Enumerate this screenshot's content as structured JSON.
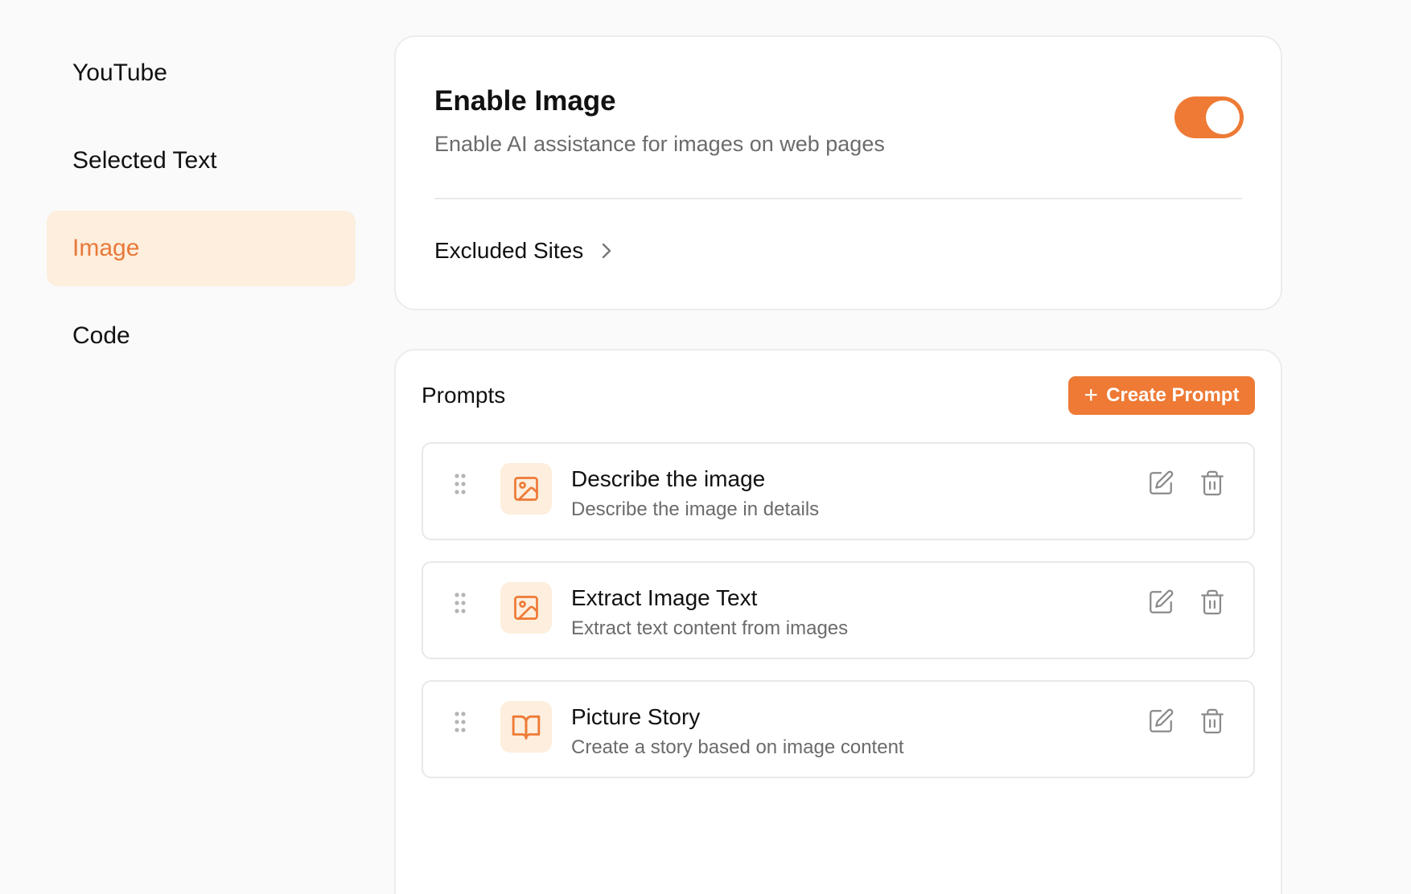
{
  "sidebar": {
    "items": [
      {
        "label": "YouTube",
        "active": false
      },
      {
        "label": "Selected Text",
        "active": false
      },
      {
        "label": "Image",
        "active": true
      },
      {
        "label": "Code",
        "active": false
      }
    ]
  },
  "enable": {
    "title": "Enable Image",
    "description": "Enable AI assistance for images on web pages",
    "toggle_on": true,
    "excluded_label": "Excluded Sites"
  },
  "prompts": {
    "title": "Prompts",
    "create_label": "Create Prompt",
    "items": [
      {
        "title": "Describe the image",
        "description": "Describe the image in details",
        "icon": "image-icon"
      },
      {
        "title": "Extract Image Text",
        "description": "Extract text content from images",
        "icon": "image-icon"
      },
      {
        "title": "Picture Story",
        "description": "Create a story based on image content",
        "icon": "book-open-icon"
      }
    ]
  },
  "colors": {
    "accent": "#ee7a35",
    "accent_soft": "#fdeedd",
    "text_primary": "#111111",
    "text_secondary": "#6b6b6b"
  }
}
